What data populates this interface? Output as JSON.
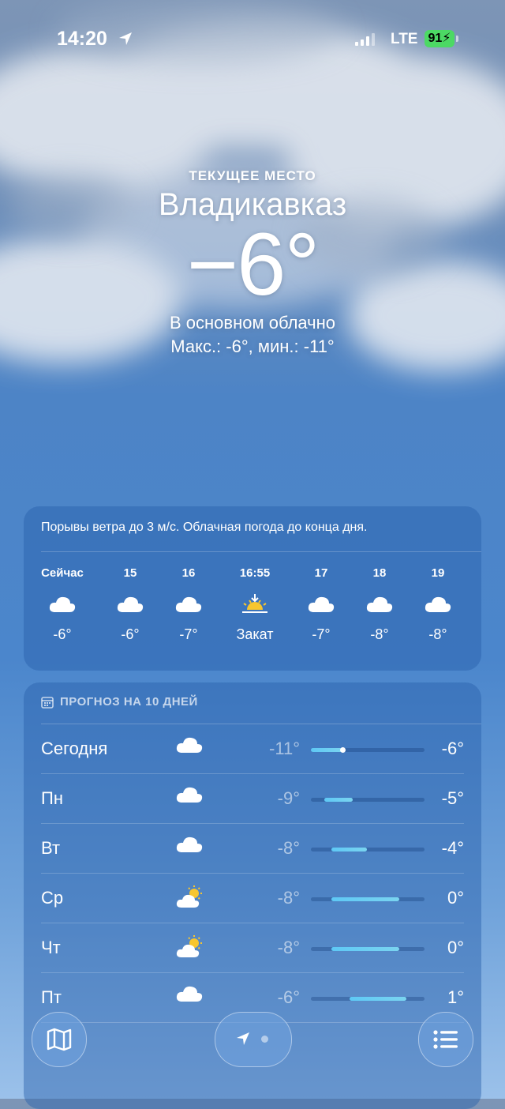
{
  "status_bar": {
    "time": "14:20",
    "network": "LTE",
    "battery": "91"
  },
  "location": {
    "label": "ТЕКУЩЕЕ МЕСТО",
    "city": "Владикавказ"
  },
  "current": {
    "temp": "−6°",
    "condition": "В основном облачно",
    "hilo": "Макс.: -6°, мин.: -11°"
  },
  "hourly": {
    "summary": "Порывы ветра до 3 м/с. Облачная погода до конца дня.",
    "items": [
      {
        "label": "Сейчас",
        "icon": "cloud-icon",
        "temp": "-6°"
      },
      {
        "label": "15",
        "icon": "cloud-icon",
        "temp": "-6°"
      },
      {
        "label": "16",
        "icon": "cloud-icon",
        "temp": "-7°"
      },
      {
        "label": "16:55",
        "icon": "sunset-icon",
        "temp": "Закат"
      },
      {
        "label": "17",
        "icon": "cloud-icon",
        "temp": "-7°"
      },
      {
        "label": "18",
        "icon": "cloud-icon",
        "temp": "-8°"
      },
      {
        "label": "19",
        "icon": "cloud-icon",
        "temp": "-8°"
      }
    ]
  },
  "forecast": {
    "title": "ПРОГНОЗ НА 10 ДНЕЙ",
    "days": [
      {
        "day": "Сегодня",
        "icon": "cloud-icon",
        "lo": "-11°",
        "hi": "-6°",
        "range": [
          0.0,
          0.28
        ],
        "current": 0.28
      },
      {
        "day": "Пн",
        "icon": "cloud-icon",
        "lo": "-9°",
        "hi": "-5°",
        "range": [
          0.12,
          0.37
        ]
      },
      {
        "day": "Вт",
        "icon": "cloud-icon",
        "lo": "-8°",
        "hi": "-4°",
        "range": [
          0.18,
          0.49
        ]
      },
      {
        "day": "Ср",
        "icon": "partly-sunny-icon",
        "lo": "-8°",
        "hi": "0°",
        "range": [
          0.18,
          0.78
        ]
      },
      {
        "day": "Чт",
        "icon": "partly-sunny-icon",
        "lo": "-8°",
        "hi": "0°",
        "range": [
          0.18,
          0.78
        ]
      },
      {
        "day": "Пт",
        "icon": "cloud-icon",
        "lo": "-6°",
        "hi": "1°",
        "range": [
          0.34,
          0.84
        ]
      }
    ]
  },
  "colors": {
    "accent": "#4a87cc",
    "bar": "#5ec8f5",
    "battery": "#4cd964"
  }
}
